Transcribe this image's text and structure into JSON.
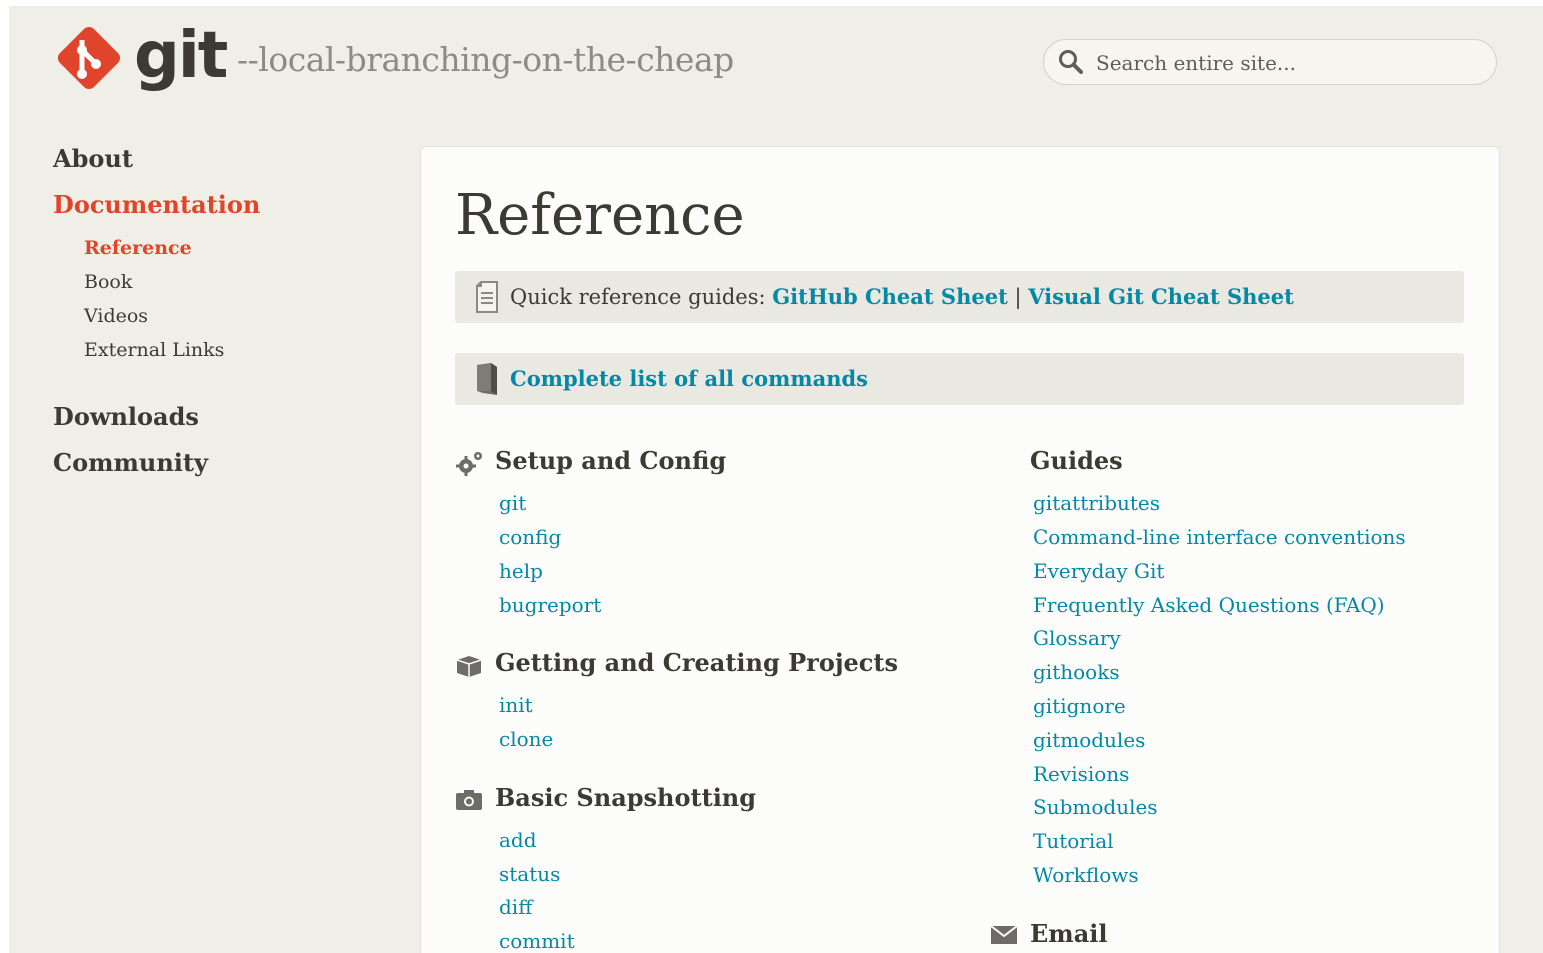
{
  "header": {
    "logo_text": "git",
    "tagline": "--local-branching-on-the-cheap",
    "search_placeholder": "Search entire site..."
  },
  "sidebar": {
    "items": [
      {
        "label": "About"
      },
      {
        "label": "Documentation",
        "active": true
      },
      {
        "label": "Downloads"
      },
      {
        "label": "Community"
      }
    ],
    "sub_items": [
      {
        "label": "Reference",
        "active": true
      },
      {
        "label": "Book"
      },
      {
        "label": "Videos"
      },
      {
        "label": "External Links"
      }
    ]
  },
  "main": {
    "title": "Reference",
    "quick_ref": {
      "prefix": "Quick reference guides: ",
      "link1": "GitHub Cheat Sheet",
      "separator": " | ",
      "link2": "Visual Git Cheat Sheet"
    },
    "all_commands": "Complete list of all commands",
    "sections": [
      {
        "title": "Setup and Config",
        "icon": "gears-icon",
        "links": [
          "git",
          "config",
          "help",
          "bugreport"
        ]
      },
      {
        "title": "Getting and Creating Projects",
        "icon": "box-icon",
        "links": [
          "init",
          "clone"
        ]
      },
      {
        "title": "Basic Snapshotting",
        "icon": "camera-icon",
        "links": [
          "add",
          "status",
          "diff",
          "commit"
        ]
      }
    ],
    "guides": {
      "title": "Guides",
      "links": [
        "gitattributes",
        "Command-line interface conventions",
        "Everyday Git",
        "Frequently Asked Questions (FAQ)",
        "Glossary",
        "githooks",
        "gitignore",
        "gitmodules",
        "Revisions",
        "Submodules",
        "Tutorial",
        "Workflows"
      ]
    },
    "email": {
      "title": "Email",
      "icon": "envelope-icon"
    }
  },
  "colors": {
    "brand": "#e0442a",
    "link": "#0388a6",
    "text": "#3c3a33",
    "background": "#f0efe7"
  }
}
